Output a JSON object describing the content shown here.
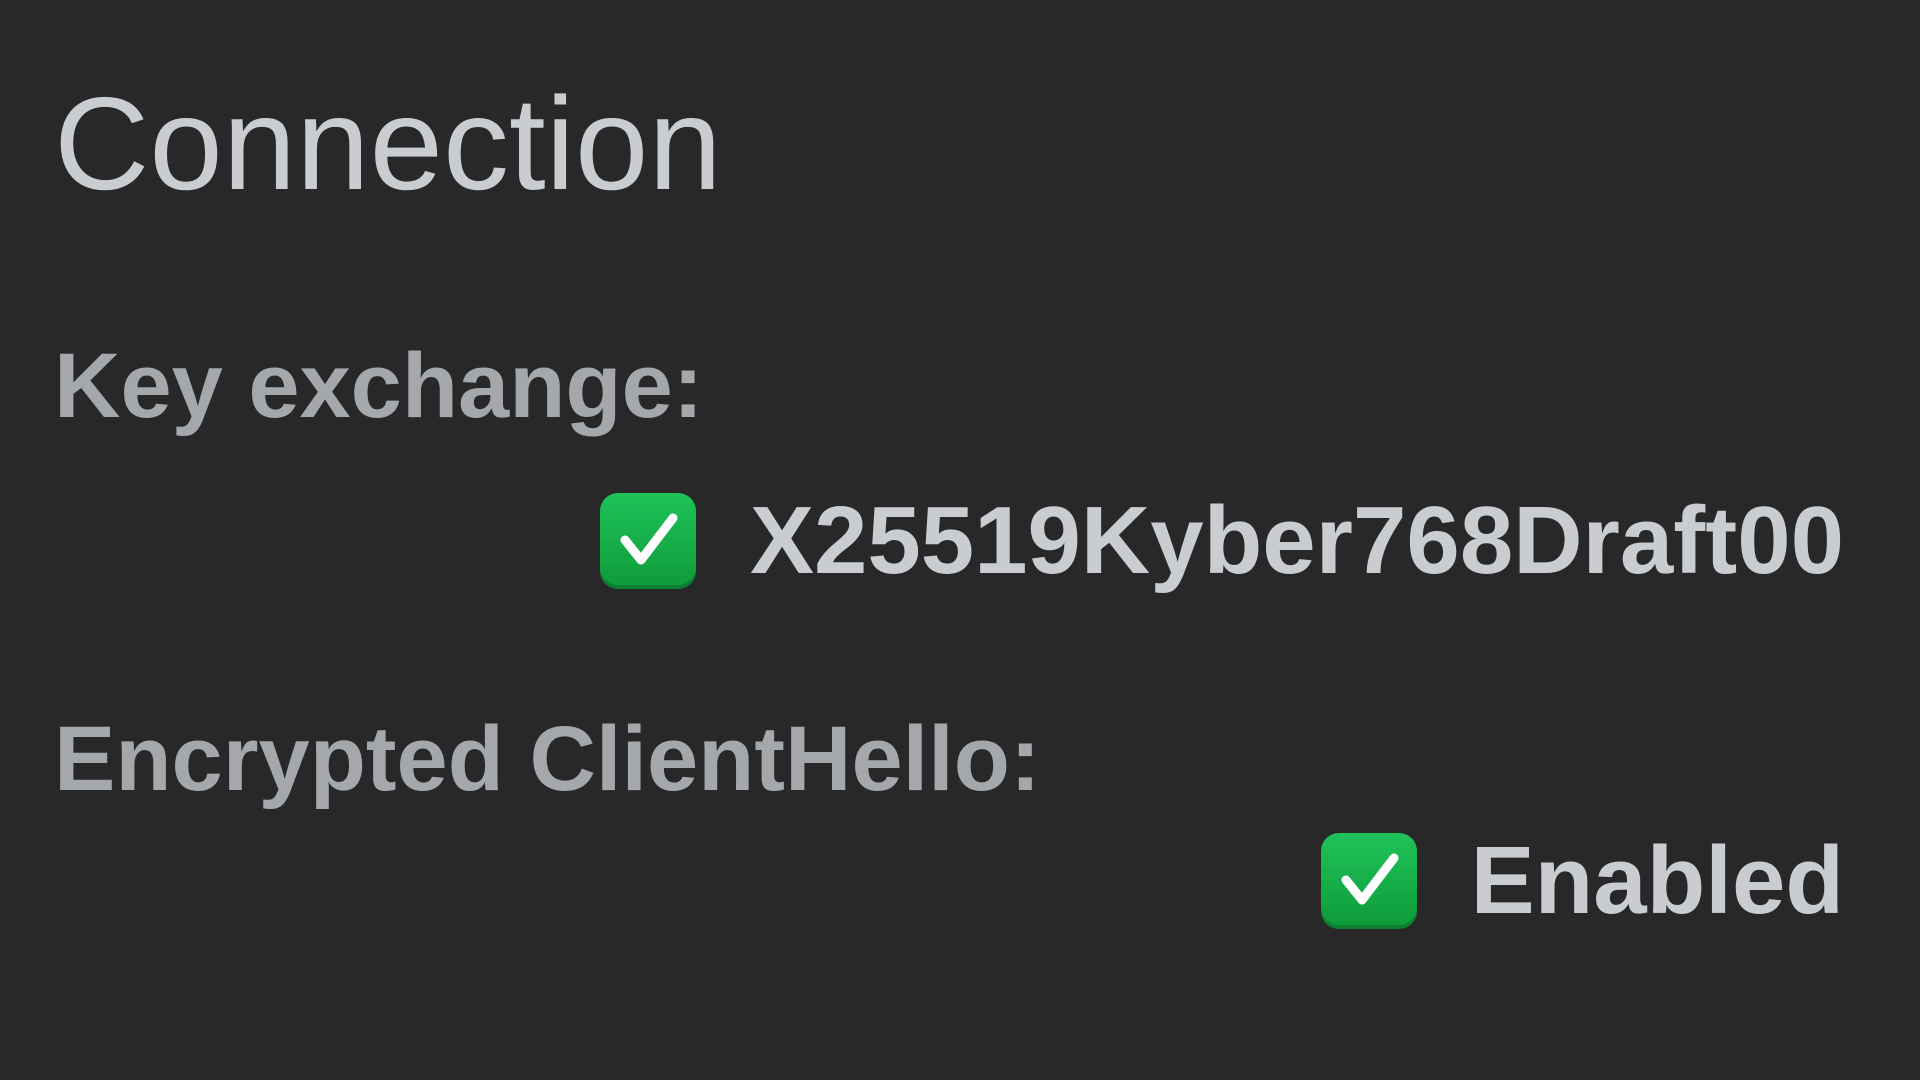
{
  "header": {
    "title": "Connection"
  },
  "rows": [
    {
      "label": "Key exchange:",
      "status_icon": "check-mark-button-icon",
      "value": "X25519Kyber768Draft00"
    },
    {
      "label": "Encrypted ClientHello:",
      "status_icon": "check-mark-button-icon",
      "value": "Enabled"
    }
  ],
  "colors": {
    "background": "#282828",
    "title": "#c9cdd2",
    "label": "#a4a7ac",
    "value": "#c9cdd2",
    "check_green": "#16b04a"
  }
}
